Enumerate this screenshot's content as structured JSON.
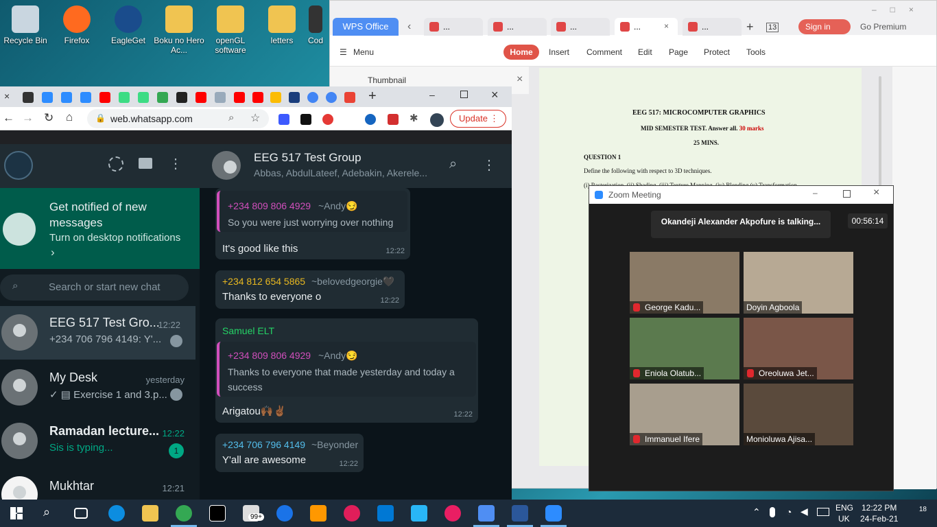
{
  "desktop": {
    "icons": [
      {
        "label": "Recycle Bin"
      },
      {
        "label": "Firefox"
      },
      {
        "label": "EagleGet"
      },
      {
        "label": "Boku no Hero Ac..."
      },
      {
        "label": "openGL software"
      },
      {
        "label": "letters"
      },
      {
        "label": "Cod"
      }
    ]
  },
  "wps": {
    "tabs": {
      "wps_office": "WPS Office",
      "count": "13",
      "sign_in": "Sign in",
      "go_premium": "Go Premium",
      "doc_ellipsis": "..."
    },
    "menu": {
      "menu": "Menu",
      "home": "Home",
      "insert": "Insert",
      "comment": "Comment",
      "edit": "Edit",
      "page": "Page",
      "protect": "Protect",
      "tools": "Tools"
    },
    "sidebar_title": "Thumbnail",
    "doc": {
      "title": "EEG 517: MICROCOMPUTER GRAPHICS",
      "subtitle_a": "MID SEMESTER TEST. Answer all. ",
      "subtitle_b": "30 marks",
      "duration": "25 MINS.",
      "q1": "QUESTION 1",
      "q1_text": "Define the following with respect to 3D techniques.",
      "q1_items": "(i) Rasterization, (ii) Shading, (iii) Texture Mapping, (iv) Blending (v) Transformation"
    }
  },
  "chrome": {
    "url": "web.whatsapp.com",
    "update": "Update"
  },
  "whatsapp": {
    "banner": {
      "title": "Get notified of new messages",
      "sub": "Turn on desktop notifications",
      "chevron": "›"
    },
    "search_placeholder": "Search or start new chat",
    "chats": [
      {
        "name": "EEG 517 Test Gro...",
        "time": "12:22",
        "sub": "+234 706 796 4149: Y'..."
      },
      {
        "name": "My Desk",
        "time": "yesterday",
        "sub": "✓ ▤ Exercise 1 and 3.p..."
      },
      {
        "name": "Ramadan lecture...",
        "time": "12:22",
        "sub": "Sis is typing...",
        "badge": "1"
      },
      {
        "name": "Mukhtar",
        "time": "12:21",
        "sub": ""
      }
    ],
    "header": {
      "title": "EEG 517 Test Group",
      "members": "Abbas, AbdulLateef, Adebakin, Akerele..."
    },
    "messages": [
      {
        "quote_sender": "+234 809 806 4929",
        "quote_alias": "~Andy😏",
        "quote_text": "So you were just worrying over nothing",
        "text": "It's good like this",
        "time": "12:22"
      },
      {
        "sender": "+234 812 654 5865",
        "alias": "~belovedgeorgie🖤",
        "text": "Thanks to everyone o",
        "time": "12:22"
      },
      {
        "sender": "Samuel ELT",
        "quote_sender": "+234 809 806 4929",
        "quote_alias": "~Andy😏",
        "quote_text_1": "Thanks to everyone that made yesterday and today a",
        "quote_text_2": "success",
        "text": "Arigatou🙌🏾✌🏾",
        "time": "12:22"
      },
      {
        "sender": "+234 706 796 4149",
        "alias": "~Beyonder",
        "text": "Y'all are awesome",
        "time": "12:22"
      }
    ]
  },
  "zoom": {
    "title": "Zoom Meeting",
    "talking": "Okandeji Alexander Akpofure is talking...",
    "timer": "00:56:14",
    "participants": [
      {
        "name": "George Kadu..."
      },
      {
        "name": "Doyin Agboola"
      },
      {
        "name": "Eniola Olatub..."
      },
      {
        "name": "Oreoluwa Jet..."
      },
      {
        "name": "Immanuel Ifere"
      },
      {
        "name": "Monioluwa Ajisa..."
      }
    ]
  },
  "taskbar": {
    "lang1": "ENG",
    "lang2": "UK",
    "time": "12:22 PM",
    "date": "24-Feb-21",
    "notif": "18",
    "badge": "99+"
  }
}
